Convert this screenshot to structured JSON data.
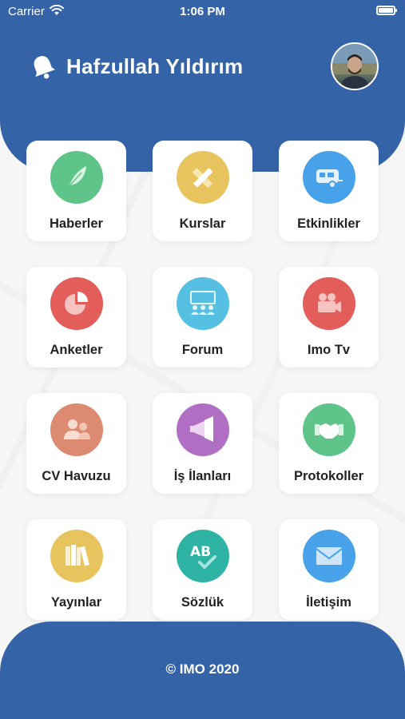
{
  "status_bar": {
    "carrier": "Carrier",
    "time": "1:06 PM"
  },
  "header": {
    "user_name": "Hafzullah Yıldırım",
    "bell_icon": "bell-icon"
  },
  "menu": {
    "items": [
      {
        "label": "Haberler",
        "icon": "feather-icon",
        "color": "#5fc48a"
      },
      {
        "label": "Kurslar",
        "icon": "pencil-ruler-icon",
        "color": "#e8c45e"
      },
      {
        "label": "Etkinlikler",
        "icon": "caravan-icon",
        "color": "#47a2ea"
      },
      {
        "label": "Anketler",
        "icon": "pie-chart-icon",
        "color": "#e35d5a"
      },
      {
        "label": "Forum",
        "icon": "audience-icon",
        "color": "#55c0e2"
      },
      {
        "label": "Imo Tv",
        "icon": "video-camera-icon",
        "color": "#e35d5a"
      },
      {
        "label": "CV Havuzu",
        "icon": "users-icon",
        "color": "#dc8a70"
      },
      {
        "label": "İş İlanları",
        "icon": "megaphone-icon",
        "color": "#b16fc4"
      },
      {
        "label": "Protokoller",
        "icon": "handshake-icon",
        "color": "#5fc48a"
      },
      {
        "label": "Yayınlar",
        "icon": "books-icon",
        "color": "#e8c45e"
      },
      {
        "label": "Sözlük",
        "icon": "ab-check-icon",
        "color": "#2eb2a4"
      },
      {
        "label": "İletişim",
        "icon": "envelope-icon",
        "color": "#47a2ea"
      }
    ]
  },
  "footer": {
    "copyright": "© IMO 2020"
  }
}
